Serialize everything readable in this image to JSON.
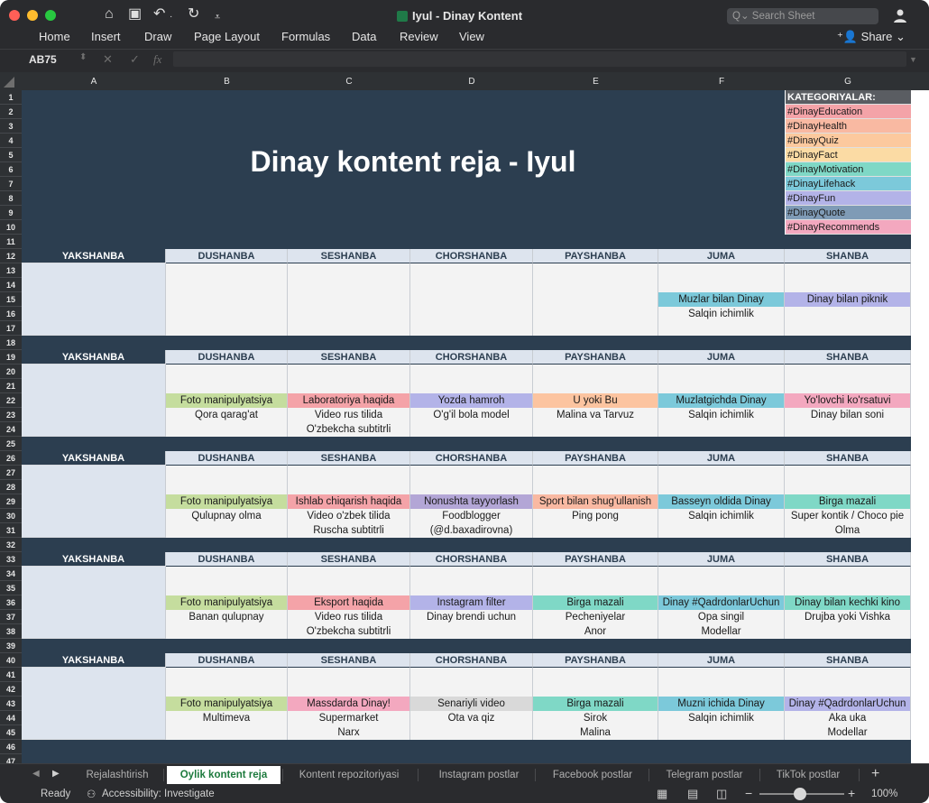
{
  "window": {
    "title": "Iyul - Dinay Kontent",
    "search_placeholder": "Search Sheet"
  },
  "menu": [
    "Home",
    "Insert",
    "Draw",
    "Page Layout",
    "Formulas",
    "Data",
    "Review",
    "View"
  ],
  "share_label": "Share",
  "formula_bar": {
    "name_box": "AB75",
    "fx": "fx"
  },
  "columns": [
    "A",
    "B",
    "C",
    "D",
    "E",
    "F",
    "G"
  ],
  "sheet_title": "Dinay kontent reja - Iyul",
  "categories_header": "KATEGORIYALAR:",
  "categories": [
    {
      "label": "#DinayEducation",
      "color": "#f4a3a8"
    },
    {
      "label": "#DinayHealth",
      "color": "#f9b9a2"
    },
    {
      "label": "#DinayQuiz",
      "color": "#fcc99e"
    },
    {
      "label": "#DinayFact",
      "color": "#fbdba4"
    },
    {
      "label": "#DinayMotivation",
      "color": "#7fd8c6"
    },
    {
      "label": "#DinayLifehack",
      "color": "#7cc9da"
    },
    {
      "label": "#DinayFun",
      "color": "#b3b3e8"
    },
    {
      "label": "#DinayQuote",
      "color": "#7f9bb6"
    },
    {
      "label": "#DinayRecommends",
      "color": "#f3a8bf"
    }
  ],
  "day_headers": [
    "YAKSHANBA",
    "DUSHANBA",
    "SESHANBA",
    "CHORSHANBA",
    "PAYSHANBA",
    "JUMA",
    "SHANBA"
  ],
  "weeks": [
    {
      "cells": [
        null,
        null,
        null,
        null,
        null,
        {
          "title": "Muzlar bilan Dinay",
          "color": "#7cc9da",
          "lines": [
            "Salqin ichimlik"
          ]
        },
        {
          "title": "Dinay bilan piknik",
          "color": "#b3b3e8",
          "lines": []
        }
      ]
    },
    {
      "cells": [
        null,
        {
          "title": "Foto manipulyatsiya",
          "color": "#c5dd9e",
          "lines": [
            "Qora qarag'at"
          ]
        },
        {
          "title": "Laboratoriya haqida",
          "color": "#f4a3a8",
          "lines": [
            "Video rus tilida",
            "O'zbekcha subtitrli"
          ]
        },
        {
          "title": "Yozda hamroh",
          "color": "#b3b3e8",
          "lines": [
            "O'g'il bola model"
          ]
        },
        {
          "title": "U yoki Bu",
          "color": "#fcc4a0",
          "lines": [
            "Malina va Tarvuz"
          ]
        },
        {
          "title": "Muzlatgichda Dinay",
          "color": "#7cc9da",
          "lines": [
            "Salqin ichimlik"
          ]
        },
        {
          "title": "Yo'lovchi ko'rsatuvi",
          "color": "#f3a8bf",
          "lines": [
            "Dinay bilan soni"
          ]
        }
      ]
    },
    {
      "cells": [
        null,
        {
          "title": "Foto manipulyatsiya",
          "color": "#c5dd9e",
          "lines": [
            "Qulupnay olma"
          ]
        },
        {
          "title": "Ishlab chiqarish haqida",
          "color": "#f4a3a8",
          "lines": [
            "Video o'zbek tilida",
            "Ruscha subtitrli"
          ]
        },
        {
          "title": "Nonushta tayyorlash",
          "color": "#b3a6d6",
          "lines": [
            "Foodblogger",
            "(@d.baxadirovna)"
          ]
        },
        {
          "title": "Sport bilan shug'ullanish",
          "color": "#f9b9a2",
          "lines": [
            "Ping pong"
          ]
        },
        {
          "title": "Basseyn oldida Dinay",
          "color": "#7cc9da",
          "lines": [
            "Salqin ichimlik"
          ]
        },
        {
          "title": "Birga mazali",
          "color": "#7fd8c6",
          "lines": [
            "Super kontik / Choco pie",
            "Olma"
          ]
        }
      ]
    },
    {
      "cells": [
        null,
        {
          "title": "Foto manipulyatsiya",
          "color": "#c5dd9e",
          "lines": [
            "Banan qulupnay"
          ]
        },
        {
          "title": "Eksport haqida",
          "color": "#f4a3a8",
          "lines": [
            "Video rus tilida",
            "O'zbekcha subtitrli"
          ]
        },
        {
          "title": "Instagram filter",
          "color": "#b3b3e8",
          "lines": [
            "Dinay brendi uchun"
          ]
        },
        {
          "title": "Birga mazali",
          "color": "#7fd8c6",
          "lines": [
            "Pecheniyelar",
            "Anor"
          ]
        },
        {
          "title": "Dinay #QadrdonlarUchun",
          "color": "#7cc9da",
          "lines": [
            "Opa singil",
            "Modellar"
          ]
        },
        {
          "title": "Dinay bilan kechki kino",
          "color": "#7fd8c6",
          "lines": [
            "Drujba yoki Vishka"
          ]
        }
      ]
    },
    {
      "cells": [
        null,
        {
          "title": "Foto manipulyatsiya",
          "color": "#c5dd9e",
          "lines": [
            "Multimeva"
          ]
        },
        {
          "title": "Massdarda Dinay!",
          "color": "#f3a8bf",
          "lines": [
            "Supermarket",
            "Narx"
          ]
        },
        {
          "title": "Senariyli video",
          "color": "#d9d9d9",
          "lines": [
            "Ota va qiz"
          ]
        },
        {
          "title": "Birga mazali",
          "color": "#7fd8c6",
          "lines": [
            "Sirok",
            "Malina"
          ]
        },
        {
          "title": "Muzni ichida Dinay",
          "color": "#7cc9da",
          "lines": [
            "Salqin ichimlik"
          ]
        },
        {
          "title": "Dinay #QadrdonlarUchun",
          "color": "#b3b3e8",
          "lines": [
            "Aka uka",
            "Modellar"
          ]
        }
      ]
    }
  ],
  "tabs": [
    "Rejalashtirish",
    "Oylik kontent reja",
    "Kontent repozitoriyasi",
    "Instagram postlar",
    "Facebook postlar",
    "Telegram postlar",
    "TikTok postlar"
  ],
  "active_tab": 1,
  "status": {
    "ready": "Ready",
    "accessibility": "Accessibility: Investigate",
    "zoom": "100%"
  }
}
